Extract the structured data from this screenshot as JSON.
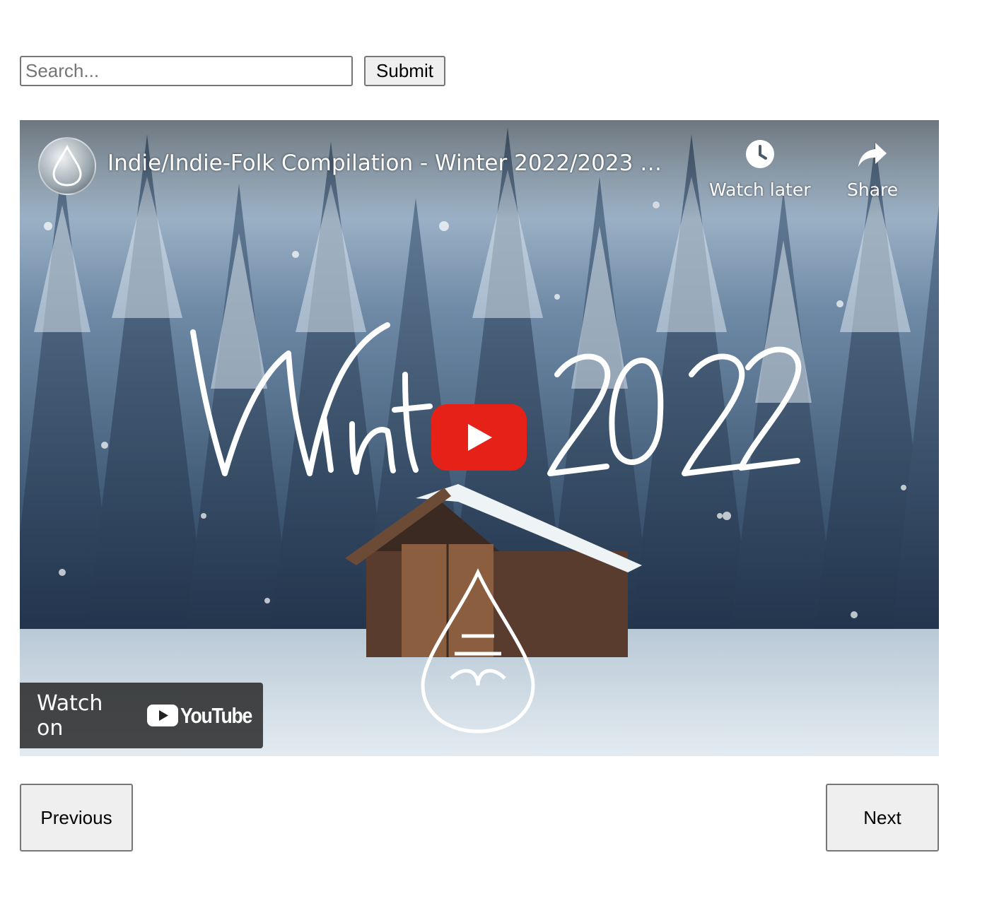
{
  "search": {
    "placeholder": "Search...",
    "value": "",
    "submit_label": "Submit"
  },
  "video": {
    "title": "Indie/Indie-Folk Compilation - Winter 2022/2023 …",
    "artwork_text": "Winter 2022",
    "actions": [
      {
        "label": "Watch later",
        "icon": "clock-icon"
      },
      {
        "label": "Share",
        "icon": "share-arrow-icon"
      }
    ],
    "watch_on_label": "Watch on",
    "platform_name": "YouTube",
    "play_color": "#e62117"
  },
  "pagination": {
    "previous_label": "Previous",
    "next_label": "Next"
  }
}
